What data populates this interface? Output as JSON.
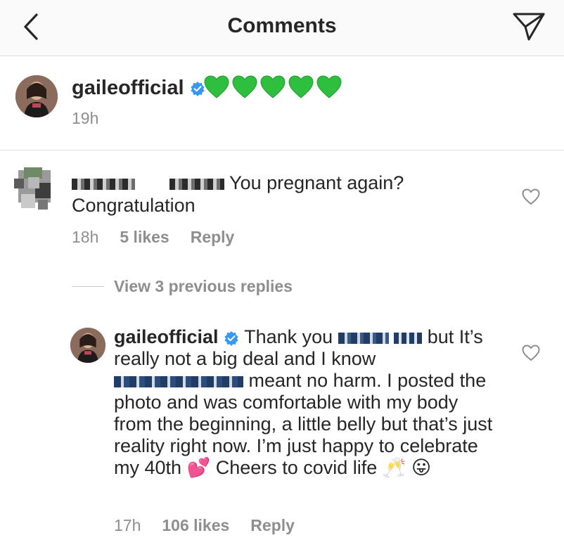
{
  "header": {
    "title": "Comments",
    "back_icon": "chevron-left-icon",
    "send_icon": "paper-plane-icon"
  },
  "caption": {
    "username": "gaileofficial",
    "emojis": "💚💚💚💚💚",
    "time": "19h"
  },
  "comment": {
    "text_line1": "You pregnant again?",
    "text_line2": "Congratulation",
    "time": "18h",
    "likes": "5 likes",
    "reply_label": "Reply"
  },
  "view_replies": "View 3 previous replies",
  "reply": {
    "username": "gaileofficial",
    "text_part1": "Thank you",
    "text_part2": "but It’s really not a big deal and I know",
    "text_part3": "meant no harm. I posted the photo and was comfortable with my body from the beginning, a little belly but that’s just reality right now. I’m just happy to celebrate my 40th",
    "text_part4": "Cheers to covid life",
    "emoji_hearts": "💕",
    "emoji_cheers": "🥂",
    "emoji_tongue": "😛",
    "time": "17h",
    "likes": "106 likes",
    "reply_label": "Reply"
  },
  "colors": {
    "verified_blue": "#3897f0",
    "green_heart": "#2ecc40",
    "muted_text": "#8e8e8e",
    "divider": "#dbdbdb"
  }
}
